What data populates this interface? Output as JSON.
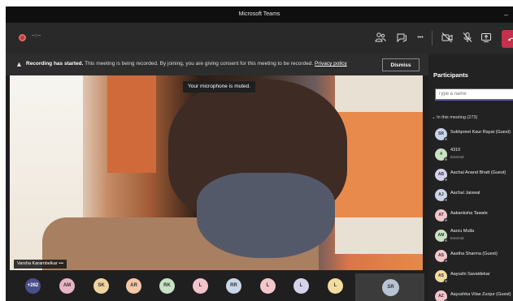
{
  "window": {
    "title": "Microsoft Teams",
    "minimize": "–"
  },
  "toolbar": {
    "timer": "--:--",
    "icons": [
      "participants-icon",
      "chat-icon",
      "more-icon",
      "camera-off-icon",
      "mic-off-icon",
      "share-icon",
      "hang-up-icon"
    ],
    "more_glyph": "•••"
  },
  "banner": {
    "bold": "Recording has started.",
    "text": " This meeting is being recorded. By joining, you are giving consent for this meeting to be recorded. ",
    "link": "Privacy policy",
    "dismiss": "Dismiss"
  },
  "video": {
    "mute_tooltip": "Your microphone is muted.",
    "speaker_name": "Varsha Karambelkar",
    "speaker_more": "•••"
  },
  "strip": {
    "avatars": [
      {
        "initials": "+262",
        "color": "#4b4e8a",
        "text": "#ffffff"
      },
      {
        "initials": "AM",
        "color": "#e8b4c4",
        "text": "#333333"
      },
      {
        "initials": "SK",
        "color": "#f0d4a0",
        "text": "#333333"
      },
      {
        "initials": "AR",
        "color": "#f3c7a8",
        "text": "#333333"
      },
      {
        "initials": "RK",
        "color": "#c9e2c3",
        "text": "#333333"
      },
      {
        "initials": "L",
        "color": "#f2c4cc",
        "text": "#333333"
      },
      {
        "initials": "RR",
        "color": "#c9d6ea",
        "text": "#333333"
      },
      {
        "initials": "L",
        "color": "#f3c7cc",
        "text": "#333333"
      },
      {
        "initials": "L",
        "color": "#d6d2ee",
        "text": "#333333"
      },
      {
        "initials": "L",
        "color": "#f4dca0",
        "text": "#333333"
      }
    ],
    "self": "SR"
  },
  "participants": {
    "title": "Participants",
    "search_placeholder": "Type a name",
    "section": "⌄  In this meeting (273)",
    "list": [
      {
        "initials": "SR",
        "name": "Sukhpreet Kaur Rayat (Guest)",
        "sub": "",
        "color": "#c9d6ea"
      },
      {
        "initials": "4",
        "name": "4310",
        "sub": "External",
        "color": "#c9e2c3"
      },
      {
        "initials": "AB",
        "name": "Aachal Anand Bhatt (Guest)",
        "sub": "",
        "color": "#d6d2ee"
      },
      {
        "initials": "AJ",
        "name": "Aachal Jaiswal",
        "sub": "",
        "color": "#c9d6ea"
      },
      {
        "initials": "AT",
        "name": "Aakanksha Tawale",
        "sub": "",
        "color": "#f2c4cc"
      },
      {
        "initials": "AM",
        "name": "Aarzu Mulla",
        "sub": "External",
        "color": "#c9e2c3"
      },
      {
        "initials": "AS",
        "name": "Aastha Sharma (Guest)",
        "sub": "",
        "color": "#f3c7cc"
      },
      {
        "initials": "AS",
        "name": "Aayushi Savaldekar",
        "sub": "",
        "color": "#f4dca0"
      },
      {
        "initials": "AZ",
        "name": "Aayushka Vilas Zunjur (Guest)",
        "sub": "",
        "color": "#f2c4cc"
      }
    ]
  }
}
